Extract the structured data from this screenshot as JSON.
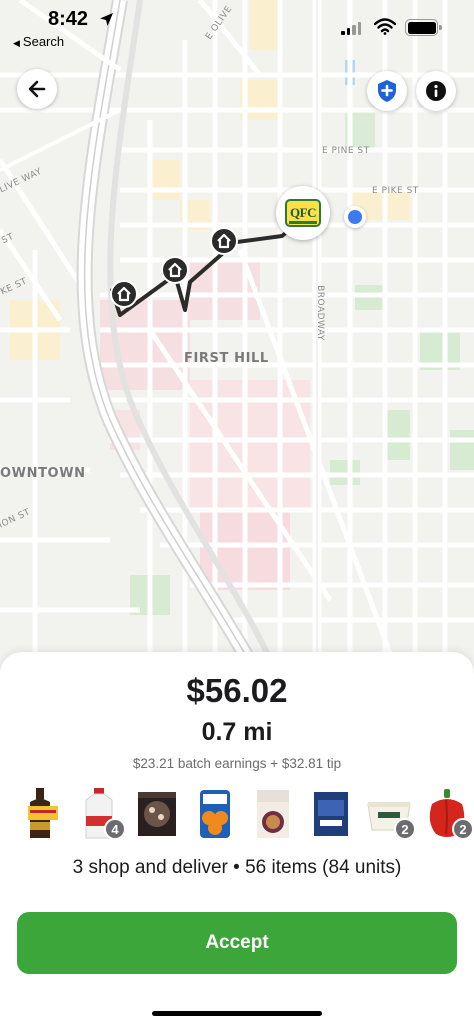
{
  "status_bar": {
    "time": "8:42",
    "back_app_label": "Search"
  },
  "map": {
    "neighborhood_labels": [
      "FIRST HILL",
      "OWNTOWN"
    ],
    "street_labels": {
      "e_olive": "E OLIVE",
      "e_pine": "E PINE ST",
      "e_pike": "E PIKE ST",
      "broadway": "BROADWAY",
      "olive_way": "LIVE WAY",
      "ke_st": "KE ST",
      "st_left": "ST",
      "ion_st": "ION ST"
    },
    "store_logo_text": "QFC",
    "icons": {
      "back": "arrow-left-icon",
      "safety": "shield-plus-icon",
      "info": "info-icon",
      "home": "home-icon",
      "location": "current-location-dot"
    },
    "route_color": "#2b2b2b"
  },
  "offer": {
    "payout": "$56.02",
    "distance": "0.7 mi",
    "breakdown": "$23.21 batch earnings + $32.81 tip",
    "items": [
      {
        "name": "coffee-liqueur-bottle",
        "badge": ""
      },
      {
        "name": "milk-gallon",
        "badge": "4"
      },
      {
        "name": "frozen-dessert-box",
        "badge": ""
      },
      {
        "name": "clementines-bag",
        "badge": ""
      },
      {
        "name": "cereal-box",
        "badge": ""
      },
      {
        "name": "blue-bag-product",
        "badge": ""
      },
      {
        "name": "yogurt-cup",
        "badge": "2"
      },
      {
        "name": "red-bell-pepper",
        "badge": "2"
      }
    ],
    "summary": "3 shop and deliver • 56 items (84 units)",
    "accept_label": "Accept"
  },
  "colors": {
    "accept_green": "#3da63a",
    "location_blue": "#3b7bef",
    "badge_gray": "#6c6c70"
  }
}
